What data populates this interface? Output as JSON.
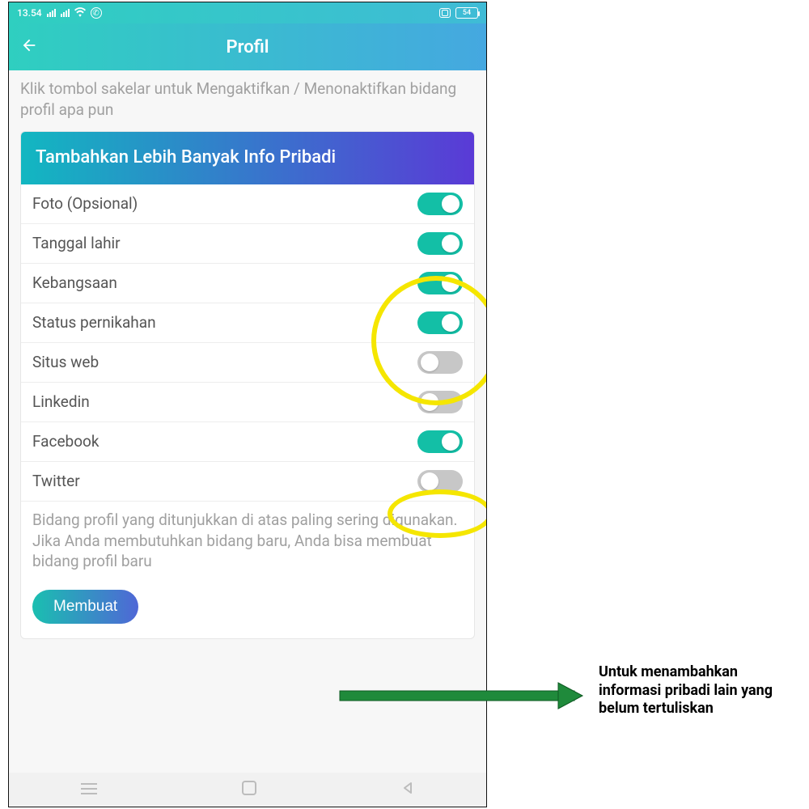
{
  "status": {
    "time": "13.54",
    "battery": "54"
  },
  "appbar": {
    "title": "Profil"
  },
  "helper_top": "Klik tombol sakelar untuk Mengaktifkan / Menonaktifkan bidang profil apa pun",
  "card": {
    "header": "Tambahkan Lebih Banyak Info Pribadi",
    "fields": [
      {
        "label": "Foto (Opsional)",
        "on": true
      },
      {
        "label": "Tanggal lahir",
        "on": true
      },
      {
        "label": "Kebangsaan",
        "on": true
      },
      {
        "label": "Status pernikahan",
        "on": true
      },
      {
        "label": "Situs web",
        "on": false
      },
      {
        "label": "Linkedin",
        "on": false
      },
      {
        "label": "Facebook",
        "on": true
      },
      {
        "label": "Twitter",
        "on": false
      }
    ],
    "helper_bottom": "Bidang profil yang ditunjukkan di atas paling sering digunakan. Jika Anda membutuhkan bidang baru, Anda bisa membuat bidang profil baru",
    "create_label": "Membuat"
  },
  "annotation": "Untuk menambahkan informasi pribadi lain yang belum tertuliskan"
}
